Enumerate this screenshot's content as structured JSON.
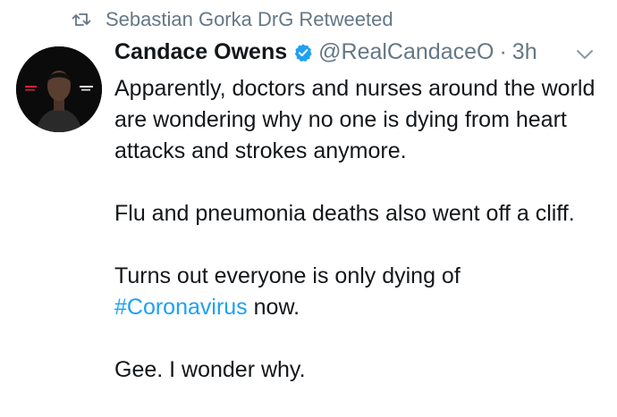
{
  "retweet": {
    "icon": "retweet-icon",
    "text": "Sebastian Gorka DrG Retweeted"
  },
  "tweet": {
    "author_name": "Candace Owens",
    "verified_icon": "verified-badge-icon",
    "handle": "@RealCandaceO",
    "separator": "·",
    "time": "3h",
    "menu_icon": "chevron-down-icon",
    "avatar_icon": "avatar",
    "paragraph1": "Apparently, doctors and nurses around the world are wondering why no one is dying from heart attacks and strokes anymore.",
    "paragraph2": "Flu and pneumonia deaths also went off a cliff.",
    "paragraph3_before": "Turns out everyone is only dying of",
    "hashtag": "#Coronavirus",
    "paragraph3_after": "now.",
    "paragraph4": "Gee. I wonder why."
  },
  "colors": {
    "text": "#14171a",
    "secondary": "#657786",
    "link": "#1da1f2",
    "verified": "#1da1f2"
  }
}
